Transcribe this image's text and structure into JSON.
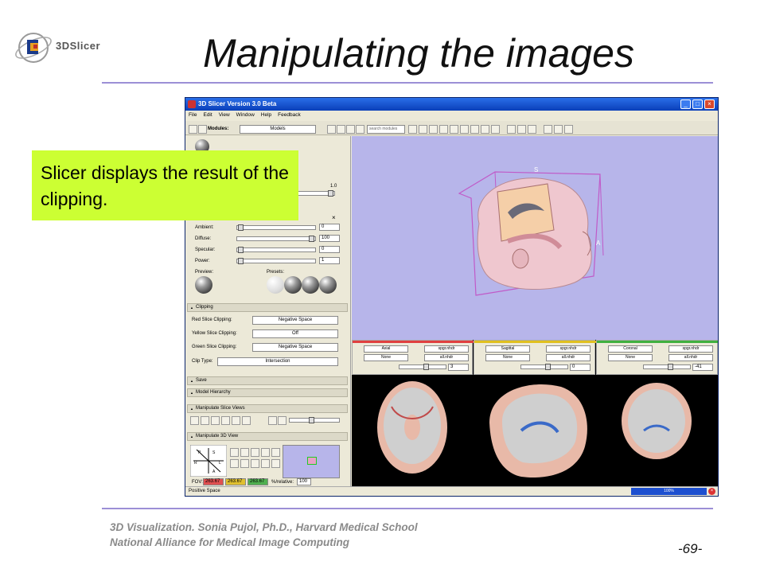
{
  "slide": {
    "logo_text": "3DSlicer",
    "title": "Manipulating the images",
    "footer_line1": "3D Visualization. Sonia Pujol, Ph.D., Harvard Medical School",
    "footer_line2": "National Alliance for Medical Image Computing",
    "page_number": "-69-",
    "callout": "Slicer displays the result of the clipping.",
    "accent_rule_color": "#9c8fd6",
    "callout_color": "#ccff33"
  },
  "app": {
    "title": "3D Slicer Version 3.0 Beta",
    "menu": [
      "File",
      "Edit",
      "View",
      "Window",
      "Help",
      "Feedback"
    ],
    "toolbar": {
      "modules_label": "Modules:",
      "modules_value": "Models",
      "search_placeholder": "search modules"
    },
    "display": {
      "slider_value_top": "1.0",
      "ambient_label": "Ambient:",
      "ambient_value": "0",
      "diffuse_label": "Diffuse:",
      "diffuse_value": "100",
      "specular_label": "Specular:",
      "specular_value": "0",
      "power_label": "Power:",
      "power_value": "1",
      "preview_label": "Preview:",
      "presets_label": "Presets:"
    },
    "clipping": {
      "header": "Clipping",
      "red_label": "Red Slice Clipping:",
      "red_value": "Negative Space",
      "yellow_label": "Yellow Slice Clipping:",
      "yellow_value": "Off",
      "green_label": "Green Slice Clipping:",
      "green_value": "Negative Space",
      "cliptype_label": "Clip Type:",
      "cliptype_value": "Intersection"
    },
    "sections": {
      "save": "Save",
      "model_hierarchy": "Model Hierarchy",
      "manipulate_slice_views": "Manipulate Slice Views",
      "manipulate_3d_view": "Manipulate 3D View"
    },
    "view3d_controls": {
      "fov_label": "FOV:",
      "fov_values": [
        "263.67",
        "263.67",
        "263.67"
      ],
      "relative_label": "%/relative:",
      "relative_value": "100"
    },
    "view3d_labels": {
      "superior": "S",
      "anterior": "A"
    },
    "slices": [
      {
        "orientation": "Axial",
        "volume": "spgr.nhdr",
        "label_none": "None",
        "label_vol": "all.nhdr",
        "offset": "3",
        "color": "#e04040"
      },
      {
        "orientation": "Sagittal",
        "volume": "spgr.nhdr",
        "label_none": "None",
        "label_vol": "all.nhdr",
        "offset": "0",
        "color": "#e0c020"
      },
      {
        "orientation": "Coronal",
        "volume": "spgr.nhdr",
        "label_none": "None",
        "label_vol": "all.nhdr",
        "offset": "-41",
        "color": "#40b040"
      }
    ],
    "status_text": "Positive Space",
    "progress_text": "100%",
    "progress_fraction": 1.0
  }
}
